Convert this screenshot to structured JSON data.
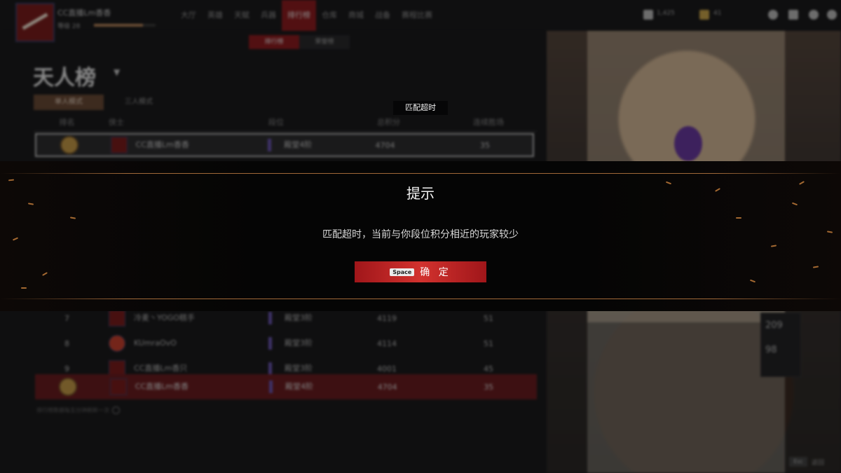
{
  "toast": {
    "text": "匹配超时"
  },
  "modal": {
    "title": "提示",
    "message": "匹配超时，当前与你段位积分相近的玩家较少",
    "confirm": {
      "key_hint": "Space",
      "label": "确 定"
    }
  },
  "background": {
    "player": {
      "name": "CC直播Lm香香",
      "level": "等级 28",
      "xp_fraction": 0.8
    },
    "nav": [
      "大厅",
      "英雄",
      "天赋",
      "兵器",
      "排行榜",
      "仓库",
      "商城",
      "战备",
      "赛程比赛"
    ],
    "nav_active_index": 4,
    "subtabs": [
      "排行榜",
      "荣誉榜"
    ],
    "currency": [
      "1,425",
      "41"
    ],
    "page": {
      "heading": "天人榜",
      "mode_tabs": [
        "单人模式",
        "三人模式"
      ]
    },
    "table": {
      "headers": [
        "排名",
        "侠士",
        "段位",
        "总积分",
        "连续胜场"
      ],
      "self_row": {
        "name": "CC直播Lm香香",
        "tier": "殿堂4阶",
        "score": "4704",
        "wins": "35"
      },
      "rows": [
        {
          "rank": "7",
          "name": "冷麦丶YOGO糕手",
          "tier": "殿堂3阶",
          "score": "4119",
          "wins": "51"
        },
        {
          "rank": "8",
          "name": "KUmraOvO",
          "tier": "殿堂3阶",
          "score": "4114",
          "wins": "51"
        },
        {
          "rank": "9",
          "name": "CC直播Lm香只",
          "tier": "殿堂3阶",
          "score": "4001",
          "wins": "45"
        }
      ]
    },
    "footnote": "排行榜数据每五分钟刷新一次",
    "side_stats": {
      "value1": "209",
      "value2": "98"
    },
    "esc": {
      "key": "Esc",
      "label": "返回"
    }
  },
  "colors": {
    "accent": "#d2322e",
    "ember": "#c07a3a"
  }
}
